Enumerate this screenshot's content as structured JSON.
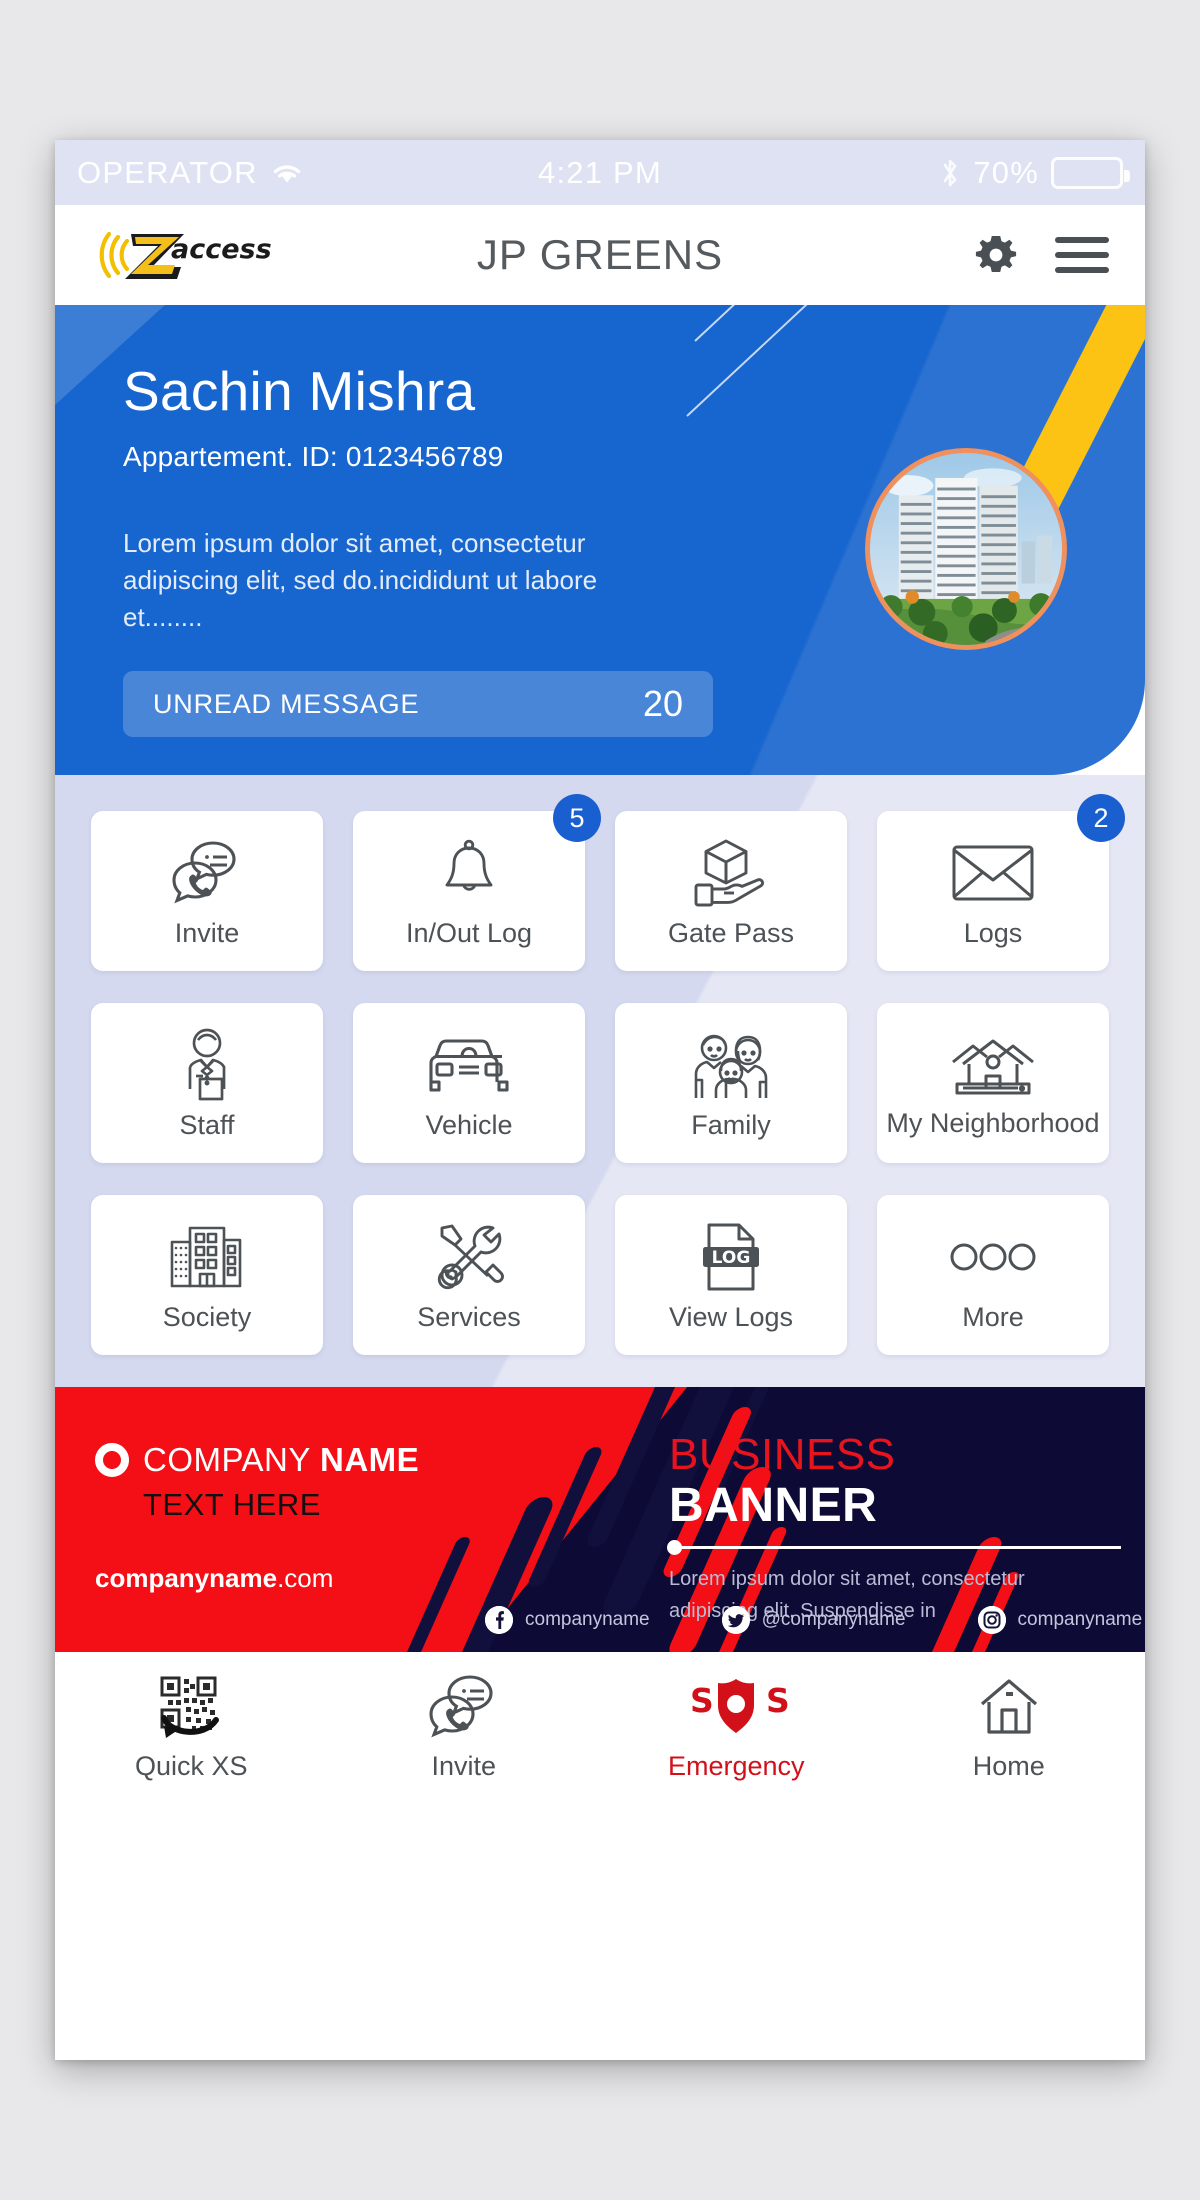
{
  "status_bar": {
    "carrier": "OPERATOR",
    "wifi_icon": "wifi-icon",
    "time": "4:21 PM",
    "bluetooth_icon": "bluetooth-icon",
    "battery_percent": "70%",
    "battery_level": 70
  },
  "app_bar": {
    "logo_text": "zaccess",
    "title": "JP GREENS",
    "settings_icon": "gear-icon",
    "menu_icon": "hamburger-menu-icon"
  },
  "profile": {
    "name": "Sachin Mishra",
    "apartment_id": "Appartement. ID: 0123456789",
    "bio": "Lorem ipsum dolor sit amet, consectetur adipiscing elit, sed do.incididunt ut labore et........",
    "unread_label": "UNREAD MESSAGE",
    "unread_count": "20",
    "avatar_icon": "building-photo",
    "card_color": "#1765ce",
    "accent_color": "#fcc315",
    "avatar_ring_color": "#f0905c"
  },
  "menu_grid": {
    "tiles": [
      {
        "label": "Invite",
        "icon": "chat-call-icon",
        "badge": null
      },
      {
        "label": "In/Out Log",
        "icon": "bell-icon",
        "badge": "5"
      },
      {
        "label": "Gate Pass",
        "icon": "package-hand-icon",
        "badge": null
      },
      {
        "label": "Logs",
        "icon": "envelope-icon",
        "badge": "2"
      },
      {
        "label": "Staff",
        "icon": "staff-person-icon",
        "badge": null
      },
      {
        "label": "Vehicle",
        "icon": "car-icon",
        "badge": null
      },
      {
        "label": "Family",
        "icon": "family-icon",
        "badge": null
      },
      {
        "label": "My Neighborhood",
        "icon": "houses-icon",
        "badge": null
      },
      {
        "label": "Society",
        "icon": "buildings-icon",
        "badge": null
      },
      {
        "label": "Services",
        "icon": "wrench-screwdriver-icon",
        "badge": null
      },
      {
        "label": "View Logs",
        "icon": "log-file-icon",
        "badge": null
      },
      {
        "label": "More",
        "icon": "three-circles-icon",
        "badge": null
      }
    ],
    "badge_color": "#1a5fd0"
  },
  "banner": {
    "logo_icon": "ring-logo-icon",
    "company_name_light": "COMPANY ",
    "company_name_bold": "NAME",
    "text_here": "TEXT HERE",
    "url_bold": "companyname",
    "url_tld": ".com",
    "headline_top": "BUSINESS",
    "headline_bottom": "BANNER",
    "description": "Lorem ipsum dolor sit amet, consectetur adipiscing elit. Suspendisse in",
    "red_color": "#f40e15",
    "dark_color": "#0d0b36",
    "socials": [
      {
        "icon": "facebook-icon",
        "handle": "companyname"
      },
      {
        "icon": "twitter-icon",
        "handle": "@companyname"
      },
      {
        "icon": "instagram-icon",
        "handle": "companyname"
      }
    ]
  },
  "bottom_nav": {
    "items": [
      {
        "label": "Quick XS",
        "icon": "qr-scan-icon",
        "active": false
      },
      {
        "label": "Invite",
        "icon": "chat-call-icon",
        "active": false
      },
      {
        "label": "Emergency",
        "icon": "sos-shield-icon",
        "active": true
      },
      {
        "label": "Home",
        "icon": "home-icon",
        "active": false
      }
    ],
    "active_color": "#d2101a"
  }
}
